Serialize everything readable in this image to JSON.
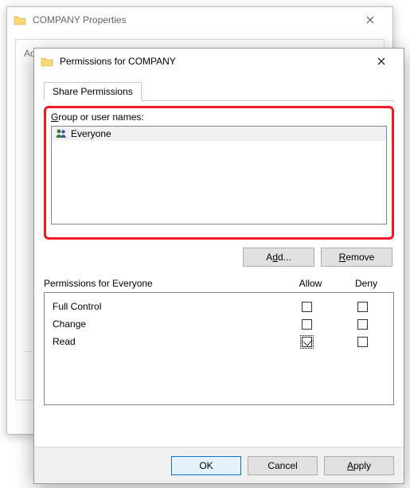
{
  "parent_window": {
    "title": "COMPANY Properties",
    "section_label": "Advanced Sharing"
  },
  "child_window": {
    "title": "Permissions for COMPANY",
    "tab_label": "Share Permissions",
    "group_label_prefix": "G",
    "group_label_rest": "roup or user names:",
    "names": [
      {
        "icon": "everyone-icon",
        "label": "Everyone"
      }
    ],
    "buttons": {
      "add_full": "Add...",
      "add_u": "d",
      "remove_full": "Remove",
      "remove_u": "R"
    },
    "perm_header_label": "Permissions for Everyone",
    "perm_col_allow": "Allow",
    "perm_col_deny": "Deny",
    "perm_rows": [
      {
        "label": "Full Control",
        "allow": false,
        "deny": false
      },
      {
        "label": "Change",
        "allow": false,
        "deny": false
      },
      {
        "label": "Read",
        "allow": true,
        "deny": false,
        "focus": true
      }
    ],
    "dlg_buttons": {
      "ok": "OK",
      "cancel": "Cancel",
      "apply_full": "Apply",
      "apply_u": "A"
    }
  }
}
